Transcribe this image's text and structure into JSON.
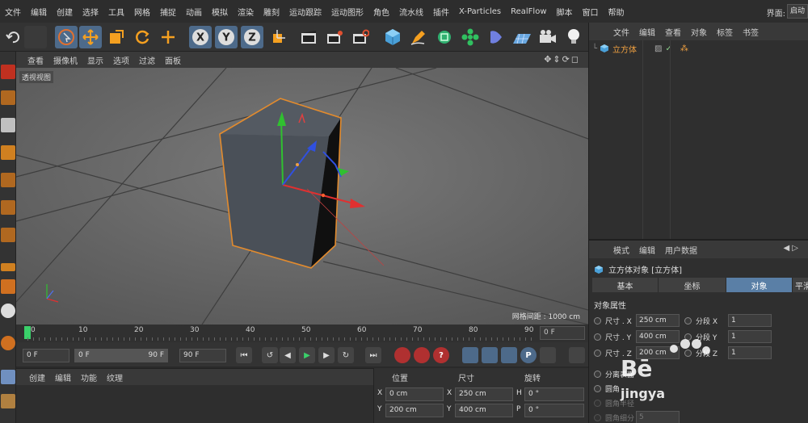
{
  "menubar": {
    "items": [
      "文件",
      "编辑",
      "创建",
      "选择",
      "工具",
      "网格",
      "捕捉",
      "动画",
      "模拟",
      "渲染",
      "雕刻",
      "运动跟踪",
      "运动图形",
      "角色",
      "流水线",
      "插件",
      "X-Particles",
      "RealFlow",
      "脚本",
      "窗口",
      "帮助"
    ],
    "interface_label": "界面:",
    "interface_value": "启动"
  },
  "viewport": {
    "menu": [
      "查看",
      "摄像机",
      "显示",
      "选项",
      "过滤",
      "面板"
    ],
    "label": "透视视图",
    "grid_distance": "网格间距 : 1000 cm"
  },
  "timeline": {
    "ticks": [
      "0",
      "10",
      "20",
      "30",
      "40",
      "50",
      "60",
      "70",
      "80",
      "90"
    ],
    "current_frame": "0 F"
  },
  "playbar": {
    "start": "0 F",
    "range_start": "0 F",
    "range_end": "90 F",
    "end": "90 F"
  },
  "material_panel": {
    "menu": [
      "创建",
      "编辑",
      "功能",
      "纹理"
    ]
  },
  "coord_panel": {
    "headers": [
      "位置",
      "尺寸",
      "旋转"
    ],
    "rows": [
      {
        "axis1": "X",
        "pos": "0 cm",
        "axis2": "X",
        "size": "250 cm",
        "axis3": "H",
        "rot": "0 °"
      },
      {
        "axis1": "Y",
        "pos": "200 cm",
        "axis2": "Y",
        "size": "400 cm",
        "axis3": "P",
        "rot": "0 °"
      }
    ]
  },
  "object_panel": {
    "menu": [
      "文件",
      "编辑",
      "查看",
      "对象",
      "标签",
      "书签"
    ],
    "object_name": "立方体"
  },
  "attr_panel": {
    "menu": [
      "模式",
      "编辑",
      "用户数据"
    ],
    "title": "立方体对象 [立方体]",
    "tabs": [
      "基本",
      "坐标",
      "对象",
      "平滑"
    ],
    "section": "对象属性",
    "rows": [
      {
        "label": "尺寸 . X",
        "value": "250 cm",
        "seg_label": "分段 X",
        "seg": "1"
      },
      {
        "label": "尺寸 . Y",
        "value": "400 cm",
        "seg_label": "分段 Y",
        "seg": "1"
      },
      {
        "label": "尺寸 . Z",
        "value": "200 cm",
        "seg_label": "分段 Z",
        "seg": "1"
      }
    ],
    "extra": [
      "分离表面",
      "圆角",
      "圆角半径",
      "圆角细分"
    ],
    "fillet_subdiv": "5"
  },
  "watermark": {
    "logo": "Bē",
    "text": "jingya"
  },
  "colors": {
    "accent": "#5a7fa6",
    "selection_orange": "#f0a040",
    "viewport_bg": "#646464",
    "axis_x": "#e03030",
    "axis_y": "#30c030",
    "axis_z": "#3050e0"
  },
  "icons": [
    "undo-icon",
    "live-select-icon",
    "move-icon",
    "scale-icon",
    "rotate-icon",
    "x-axis-icon",
    "y-axis-icon",
    "z-axis-icon",
    "coordinate-icon",
    "render-view-icon",
    "render-icon",
    "render-settings-icon",
    "cube-icon",
    "pen-icon",
    "subdivision-icon",
    "cloner-icon",
    "deformer-icon",
    "floor-icon",
    "camera-icon",
    "light-icon"
  ]
}
